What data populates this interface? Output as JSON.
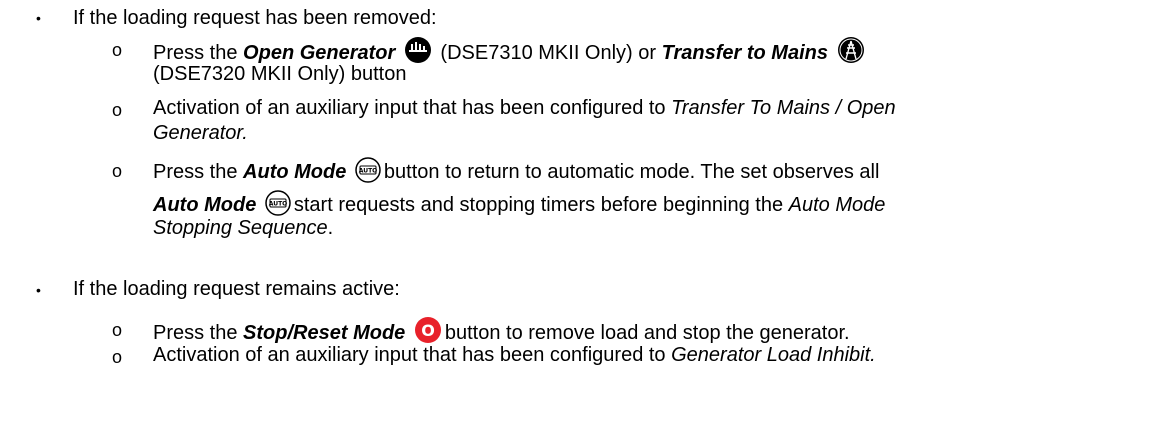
{
  "list": {
    "item1": {
      "bullet": "•",
      "text": "If the loading request has been removed:",
      "sub1": {
        "marker": "o",
        "pre": "Press the ",
        "em1": "Open Generator",
        "mid": " (DSE7310 MKII Only) or ",
        "em2": "Transfer to Mains",
        "post": "(DSE7320 MKII Only) button"
      },
      "sub2": {
        "marker": "o",
        "pre": "Activation of an auxiliary input that has been configured to ",
        "em": "Transfer To Mains / Open",
        "em_cont": "Generator."
      },
      "sub3": {
        "marker": "o",
        "pre": "Press the ",
        "em1": "Auto Mode",
        "mid": "button to return to automatic mode. The set observes all",
        "em2": "Auto Mode",
        "mid2": "start requests and stopping timers before beginning the ",
        "em3": "Auto Mode",
        "em3_cont": "Stopping Sequence",
        "end": "."
      }
    },
    "item2": {
      "bullet": "•",
      "text": "If the loading request remains active:",
      "sub1": {
        "marker": "o",
        "pre": "Press the ",
        "em": "Stop/Reset Mode",
        "post": "button to remove load and stop the generator."
      },
      "sub2": {
        "marker": "o",
        "pre": "Activation of an auxiliary input that has been configured to ",
        "em": "Generator Load Inhibit."
      }
    }
  },
  "icons": {
    "open_generator": "open-generator-icon",
    "transfer_mains": "transfer-to-mains-icon",
    "auto_mode": "auto-mode-icon",
    "stop_reset": "stop-reset-icon",
    "auto_label": "AUTO",
    "stop_label": "O",
    "stop_color": "#e8212a"
  }
}
